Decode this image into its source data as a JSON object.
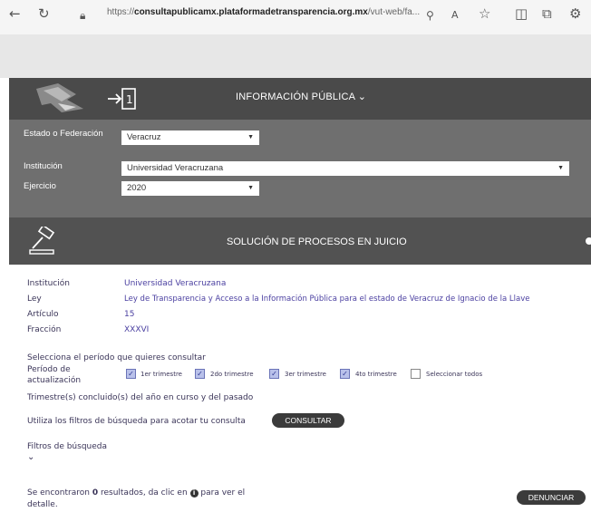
{
  "browser": {
    "url_prefix": "https://",
    "url_host": "consultapublicamx.plataformadetransparencia.org.mx",
    "url_path": "/vut-web/fa..."
  },
  "header": {
    "info_title": "INFORMACIÓN PÚBLICA ⌄"
  },
  "filters": {
    "estado_label": "Estado o Federación",
    "estado_value": "Veracruz",
    "institucion_label": "Institución",
    "institucion_value": "Universidad Veracruzana",
    "ejercicio_label": "Ejercicio",
    "ejercicio_value": "2020"
  },
  "section": {
    "title": "SOLUCIÓN DE PROCESOS EN JUICIO"
  },
  "info": {
    "institucion_label": "Institución",
    "institucion_value": "Universidad Veracruzana",
    "ley_label": "Ley",
    "ley_value": "Ley de Transparencia y Acceso a la Información Pública para el estado de Veracruz de Ignacio de la Llave",
    "articulo_label": "Artículo",
    "articulo_value": "15",
    "fraccion_label": "Fracción",
    "fraccion_value": "XXXVI"
  },
  "periodo": {
    "prompt": "Selecciona el período que quieres consultar",
    "label_line1": "Período de",
    "label_line2": "actualización",
    "options": [
      "1er trimestre",
      "2do trimestre",
      "3er trimestre",
      "4to trimestre",
      "Seleccionar todos"
    ],
    "note": "Trimestre(s) concluido(s) del año en curso y del pasado"
  },
  "consulta": {
    "prompt": "Utiliza los filtros de búsqueda para acotar tu consulta",
    "button": "CONSULTAR"
  },
  "busqueda": {
    "label": "Filtros de búsqueda"
  },
  "resultados": {
    "text_before": "Se encontraron ",
    "count": "0",
    "text_after": " resultados, da clic en ",
    "text_end": " para ver el",
    "line2": "detalle."
  },
  "denunciar_button": "DENUNCIAR"
}
